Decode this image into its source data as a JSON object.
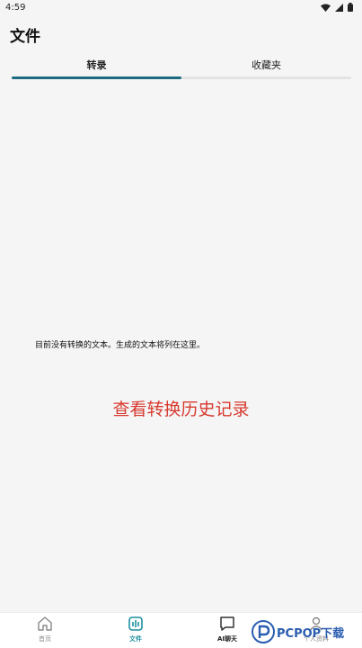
{
  "status_bar": {
    "time": "4:59"
  },
  "app": {
    "title": "文件"
  },
  "tabs": [
    {
      "label": "转录",
      "active": true
    },
    {
      "label": "收藏夹",
      "active": false
    }
  ],
  "content": {
    "empty_message": "目前没有转换的文本。生成的文本将列在这里。",
    "history_link": "查看转换历史记录"
  },
  "bottom_nav": {
    "items": [
      {
        "label": "首页",
        "icon": "home-icon"
      },
      {
        "label": "文件",
        "icon": "files-icon",
        "active": true
      },
      {
        "label": "AI聊天",
        "icon": "chat-icon"
      },
      {
        "label": "个人资料",
        "icon": "profile-icon"
      }
    ]
  },
  "watermark": {
    "brand": "PCPOP下载"
  },
  "colors": {
    "accent": "#1e6a80",
    "nav_active": "#1e8fa0",
    "link_red": "#d63a2f"
  }
}
